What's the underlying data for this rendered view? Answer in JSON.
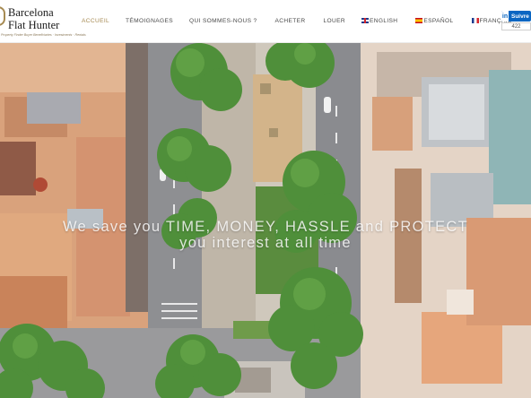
{
  "logo": {
    "line1": "Barcelona",
    "line2": "Flat Hunter",
    "tagline": "Property Finder Buyer Beneficiaries · Investments · Rentals"
  },
  "nav": {
    "home": "ACCUEIL",
    "testimonials": "TÉMOIGNAGES",
    "about": "QUI SOMMES-NOUS ?",
    "buy": "ACHETER",
    "rent": "LOUER",
    "english": "ENGLISH",
    "spanish": "ESPAÑOL",
    "french": "FRANÇAIS"
  },
  "social": {
    "network": "in",
    "follow_label": "Suivre",
    "followers": "422"
  },
  "hero": {
    "tagline_line1": "We save you TIME, MONEY, HASSLE and PROTECT",
    "tagline_line2": "you interest at all time"
  },
  "colors": {
    "accent_gold": "#a68a52",
    "nav_text": "#4a4a4a",
    "linkedin": "#0a66c2",
    "tree_green": "#4f8f3a",
    "roof_terracotta": "#c9835a"
  },
  "icons": [
    "flag-uk-icon",
    "flag-es-icon",
    "flag-fr-icon",
    "linkedin-icon"
  ]
}
